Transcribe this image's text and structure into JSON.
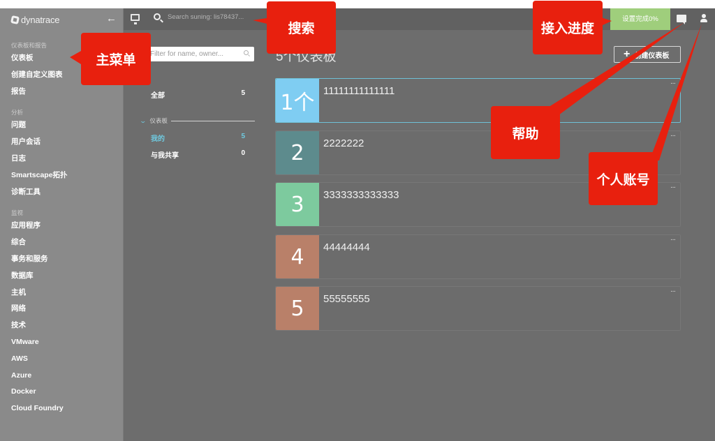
{
  "app": {
    "logo_text": "dynatrace",
    "colors": {
      "sidebar_bg": "#8a8a8a",
      "main_bg": "#6d6d6d",
      "topbar_bg": "#616161",
      "accent": "#6fc9df",
      "setup_green": "#9fce7c",
      "callout_red": "#e8200e"
    }
  },
  "sidebar": {
    "back_icon": "arrow-left-icon",
    "sections": [
      {
        "title": "仪表板和报告",
        "items": [
          "仪表板",
          "创建自定义图表",
          "报告"
        ]
      },
      {
        "title": "分析",
        "items": [
          "问题",
          "用户会话",
          "日志",
          "Smartscape拓扑",
          "诊断工具"
        ]
      },
      {
        "title": "监视",
        "items": [
          "应用程序",
          "综合",
          "事务和服务",
          "数据库",
          "主机",
          "网络",
          "技术",
          "VMware",
          "AWS",
          "Azure",
          "Docker",
          "Cloud Foundry"
        ]
      }
    ]
  },
  "topbar": {
    "monitor_icon": "monitor-icon",
    "search_placeholder": "Search suning: lis78437...",
    "setup_label": "设置完成0%",
    "setup_progress_percent": 0,
    "help_icon": "chat-bubble-icon",
    "user_icon": "user-icon"
  },
  "filter": {
    "placeholder": "Filter for name, owner...",
    "all": {
      "label": "全部",
      "count": "5"
    },
    "group_label": "仪表板",
    "items": [
      {
        "label": "我的",
        "count": "5",
        "active": true
      },
      {
        "label": "与我共享",
        "count": "0",
        "active": false
      }
    ]
  },
  "main": {
    "title": "5个仪表板",
    "create_label": "创建仪表板",
    "more_label": "···",
    "dashboards": [
      {
        "badge": "1个",
        "name": "11111111111111",
        "color": "#7fcdf2",
        "selected": true
      },
      {
        "badge": "2",
        "name": "2222222",
        "color": "#5d8b8d",
        "selected": false
      },
      {
        "badge": "3",
        "name": "3333333333333",
        "color": "#7dca9e",
        "selected": false
      },
      {
        "badge": "4",
        "name": "44444444",
        "color": "#b98069",
        "selected": false
      },
      {
        "badge": "5",
        "name": "55555555",
        "color": "#b98069",
        "selected": false
      }
    ]
  },
  "annotations": {
    "main_menu": "主菜单",
    "search": "搜索",
    "onboarding": "接入进度",
    "help": "帮助",
    "account": "个人账号"
  }
}
